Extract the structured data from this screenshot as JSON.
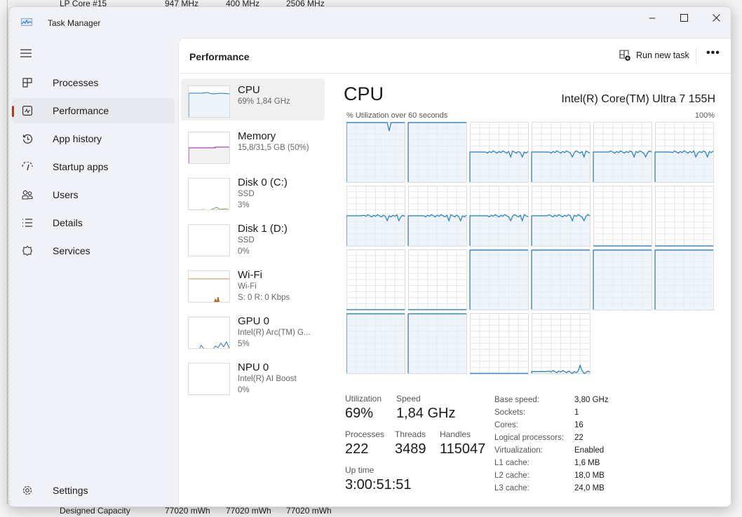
{
  "background": {
    "top_row": [
      "LP Core #15",
      "947 MHz",
      "400 MHz",
      "2506 MHz"
    ],
    "bottom_row": [
      "Designed Capacity",
      "77020 mWh",
      "77020 mWh",
      "77020 mWh"
    ]
  },
  "window": {
    "title": "Task Manager",
    "controls": [
      "minimize",
      "maximize",
      "close"
    ]
  },
  "sidebar": {
    "menu_icon": "hamburger-icon",
    "items": [
      {
        "label": "Processes",
        "icon": "processes-icon"
      },
      {
        "label": "Performance",
        "icon": "performance-icon",
        "active": true
      },
      {
        "label": "App history",
        "icon": "history-icon"
      },
      {
        "label": "Startup apps",
        "icon": "startup-icon"
      },
      {
        "label": "Users",
        "icon": "users-icon"
      },
      {
        "label": "Details",
        "icon": "details-icon"
      },
      {
        "label": "Services",
        "icon": "services-icon"
      }
    ],
    "settings": {
      "label": "Settings",
      "icon": "gear-icon"
    }
  },
  "header": {
    "title": "Performance",
    "run_new_task": "Run new task",
    "more": "•••"
  },
  "resources": [
    {
      "name": "CPU",
      "sub1": "69% 1,84 GHz",
      "sub2": "",
      "color": "#1f7ac8",
      "active": true
    },
    {
      "name": "Memory",
      "sub1": "15,8/31,5 GB (50%)",
      "sub2": "",
      "color": "#8b1fa8"
    },
    {
      "name": "Disk 0 (C:)",
      "sub1": "SSD",
      "sub2": "3%",
      "color": "#4c8a1f"
    },
    {
      "name": "Disk 1 (D:)",
      "sub1": "SSD",
      "sub2": "0%",
      "color": "#4c8a1f"
    },
    {
      "name": "Wi-Fi",
      "sub1": "Wi-Fi",
      "sub2": "S: 0 R: 0 Kbps",
      "color": "#a75b12"
    },
    {
      "name": "GPU 0",
      "sub1": "Intel(R) Arc(TM) G...",
      "sub2": "5%",
      "color": "#1f7ac8"
    },
    {
      "name": "NPU 0",
      "sub1": "Intel(R) AI Boost",
      "sub2": "0%",
      "color": "#1f7ac8"
    }
  ],
  "cpu": {
    "title": "CPU",
    "model": "Intel(R) Core(TM) Ultra 7 155H",
    "graph_label": "% Utilization over 60 seconds",
    "graph_max": "100%",
    "stats": {
      "utilization": {
        "label": "Utilization",
        "value": "69%"
      },
      "speed": {
        "label": "Speed",
        "value": "1,84 GHz"
      },
      "processes": {
        "label": "Processes",
        "value": "222"
      },
      "threads": {
        "label": "Threads",
        "value": "3489"
      },
      "handles": {
        "label": "Handles",
        "value": "115047"
      },
      "uptime": {
        "label": "Up time",
        "value": "3:00:51:51"
      }
    },
    "specs": [
      {
        "k": "Base speed:",
        "v": "3,80 GHz"
      },
      {
        "k": "Sockets:",
        "v": "1"
      },
      {
        "k": "Cores:",
        "v": "16"
      },
      {
        "k": "Logical processors:",
        "v": "22"
      },
      {
        "k": "Virtualization:",
        "v": "Enabled"
      },
      {
        "k": "L1 cache:",
        "v": "1,6 MB"
      },
      {
        "k": "L2 cache:",
        "v": "18,0 MB"
      },
      {
        "k": "L3 cache:",
        "v": "24,0 MB"
      }
    ]
  },
  "chart_data": {
    "type": "line",
    "title": "% Utilization over 60 seconds",
    "ylim": [
      0,
      100
    ],
    "grid": true,
    "color": "#1f7ac8",
    "series_current_percent": [
      100,
      100,
      50,
      50,
      50,
      50,
      50,
      50,
      50,
      50,
      0,
      0,
      0,
      0,
      100,
      100,
      100,
      100,
      100,
      100,
      0,
      3
    ]
  }
}
